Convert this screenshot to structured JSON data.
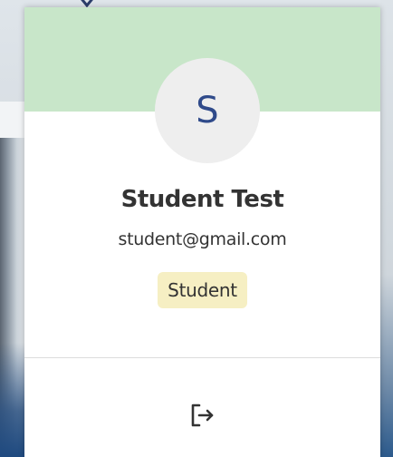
{
  "profile": {
    "avatar_initial": "S",
    "name": "Student Test",
    "email": "student@gmail.com",
    "role": "Student"
  },
  "actions": {
    "logout_icon": "logout-icon"
  },
  "colors": {
    "banner": "#c8e6c9",
    "avatar_bg": "#eeeeee",
    "avatar_text": "#2f4a8a",
    "role_badge_bg": "#f6efc3",
    "text": "#333333"
  }
}
